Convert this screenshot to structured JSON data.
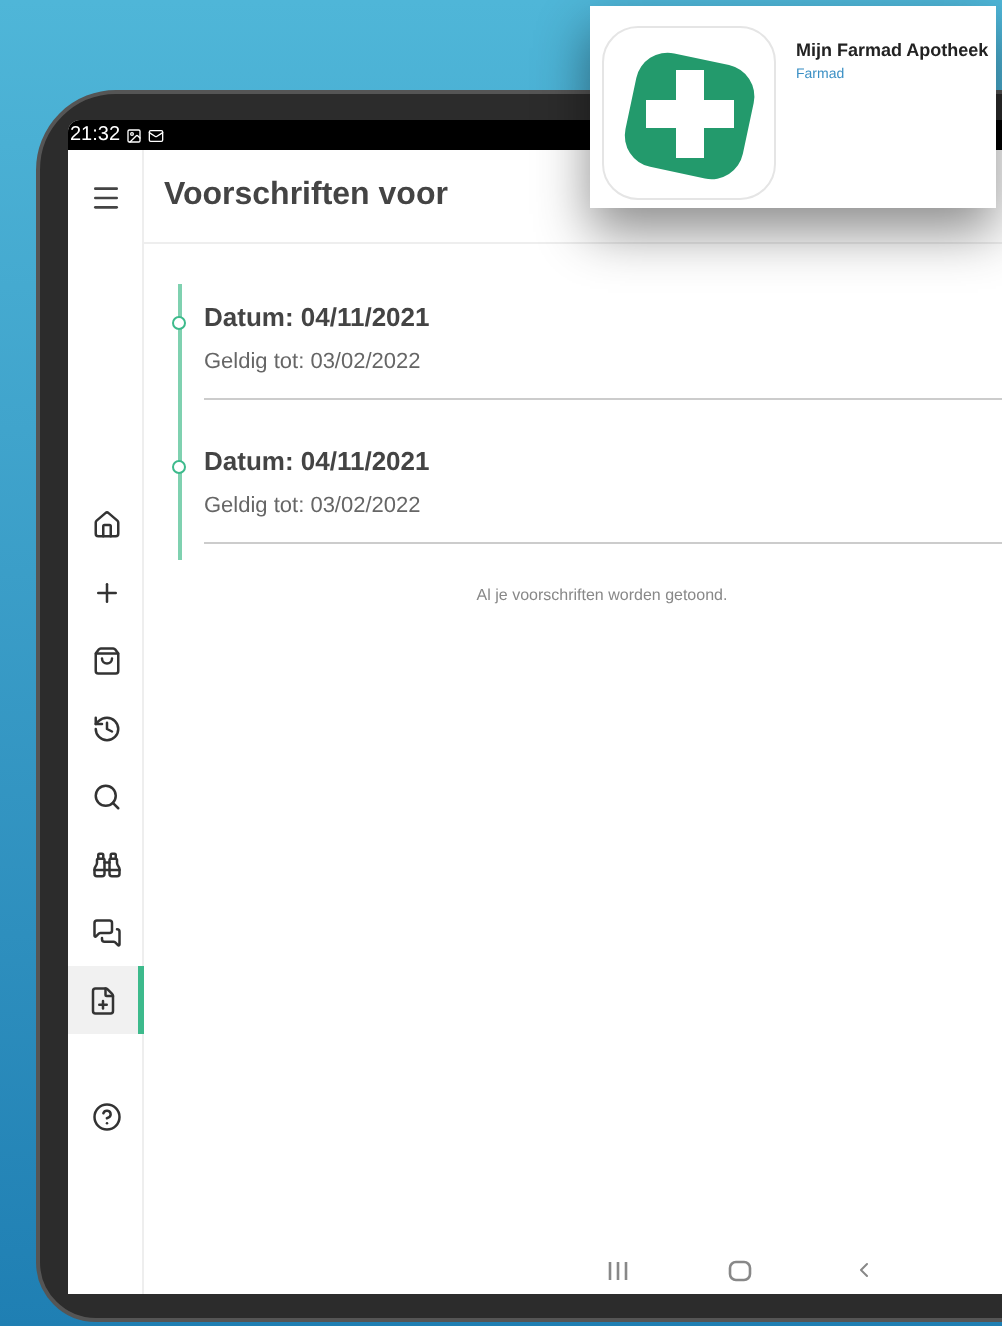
{
  "status_bar": {
    "time": "21:32"
  },
  "app_card": {
    "name": "Mijn Farmad Apotheek",
    "developer": "Farmad"
  },
  "header": {
    "title": "Voorschriften voor"
  },
  "sidebar": {
    "items": [
      {
        "kind": "home",
        "selected": false
      },
      {
        "kind": "add",
        "selected": false
      },
      {
        "kind": "bag",
        "selected": false
      },
      {
        "kind": "history",
        "selected": false
      },
      {
        "kind": "search",
        "selected": false
      },
      {
        "kind": "binoculars",
        "selected": false
      },
      {
        "kind": "chat",
        "selected": false
      },
      {
        "kind": "prescription",
        "selected": true
      },
      {
        "kind": "help",
        "selected": false
      }
    ]
  },
  "prescriptions": [
    {
      "date": "Datum: 04/11/2021",
      "valid_until": "Geldig tot: 03/02/2022"
    },
    {
      "date": "Datum: 04/11/2021",
      "valid_until": "Geldig tot: 03/02/2022"
    }
  ],
  "footer_note": "Al je voorschriften worden getoond."
}
